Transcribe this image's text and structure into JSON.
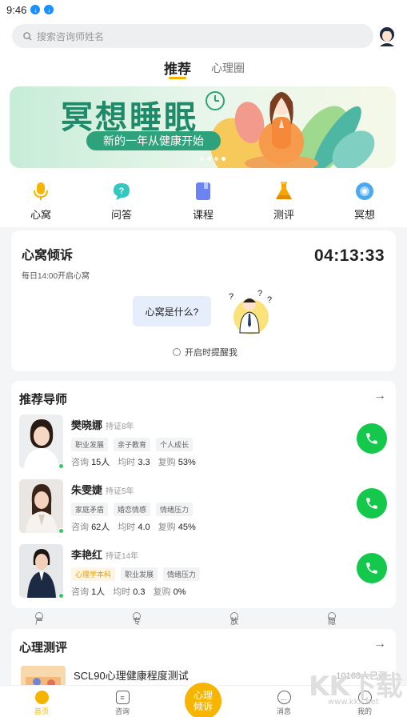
{
  "status_bar": {
    "time": "9:46"
  },
  "search": {
    "placeholder": "搜索咨询师姓名"
  },
  "tabs": [
    {
      "label": "推荐",
      "active": true
    },
    {
      "label": "心理圈",
      "active": false
    }
  ],
  "banner": {
    "title": "冥想睡眠",
    "subtitle": "新的一年从健康开始",
    "slide_count": 4,
    "active_slide": 4
  },
  "quick_nav": [
    {
      "label": "心窝",
      "icon": "microphone-icon"
    },
    {
      "label": "问答",
      "icon": "question-bubble-icon"
    },
    {
      "label": "课程",
      "icon": "book-icon"
    },
    {
      "label": "测评",
      "icon": "flask-icon"
    },
    {
      "label": "冥想",
      "icon": "meditation-icon"
    }
  ],
  "xinwo": {
    "title": "心窝倾诉",
    "subtitle": "每日14:00开启心窝",
    "countdown": "04:13:33",
    "bubble": "心窝是什么?",
    "remind_label": "开启时提醒我"
  },
  "mentors": {
    "title": "推荐导师",
    "items": [
      {
        "name": "樊晓娜",
        "cert": "持证8年",
        "tags": [
          "职业发展",
          "亲子教育",
          "个人成长"
        ],
        "highlight_tags": [],
        "consult_label": "咨询",
        "consult": "15人",
        "hour_label": "均时",
        "hour": "3.3",
        "repeat_label": "复购",
        "repeat": "53%"
      },
      {
        "name": "朱雯婕",
        "cert": "持证5年",
        "tags": [
          "家庭矛盾",
          "婚恋情感",
          "情绪压力"
        ],
        "highlight_tags": [],
        "consult_label": "咨询",
        "consult": "62人",
        "hour_label": "均时",
        "hour": "4.0",
        "repeat_label": "复购",
        "repeat": "45%"
      },
      {
        "name": "李艳红",
        "cert": "持证14年",
        "tags": [
          "心理学本科",
          "职业发展",
          "情绪压力"
        ],
        "highlight_tags": [
          "心理学本科"
        ],
        "consult_label": "咨询",
        "consult": "1人",
        "hour_label": "均时",
        "hour": "0.3",
        "repeat_label": "复购",
        "repeat": "0%"
      }
    ]
  },
  "guarantees": [
    "严选师资",
    "专业咨询",
    "放心价格",
    "隐私保障"
  ],
  "tests": {
    "title": "心理测评",
    "item": {
      "name": "SCL90心理健康程度测试",
      "count": "10163人已测"
    }
  },
  "bottom_nav": [
    {
      "label": "首页",
      "active": true
    },
    {
      "label": "咨询",
      "active": false
    },
    {
      "label": "心理倾诉",
      "active": false
    },
    {
      "label": "消息",
      "active": false
    },
    {
      "label": "我的",
      "active": false
    }
  ],
  "watermark": {
    "text": "KK下载",
    "url": "www.kkx.net"
  },
  "colors": {
    "accent": "#f5b400",
    "call": "#13c84a",
    "banner_green": "#1e8a6a"
  }
}
